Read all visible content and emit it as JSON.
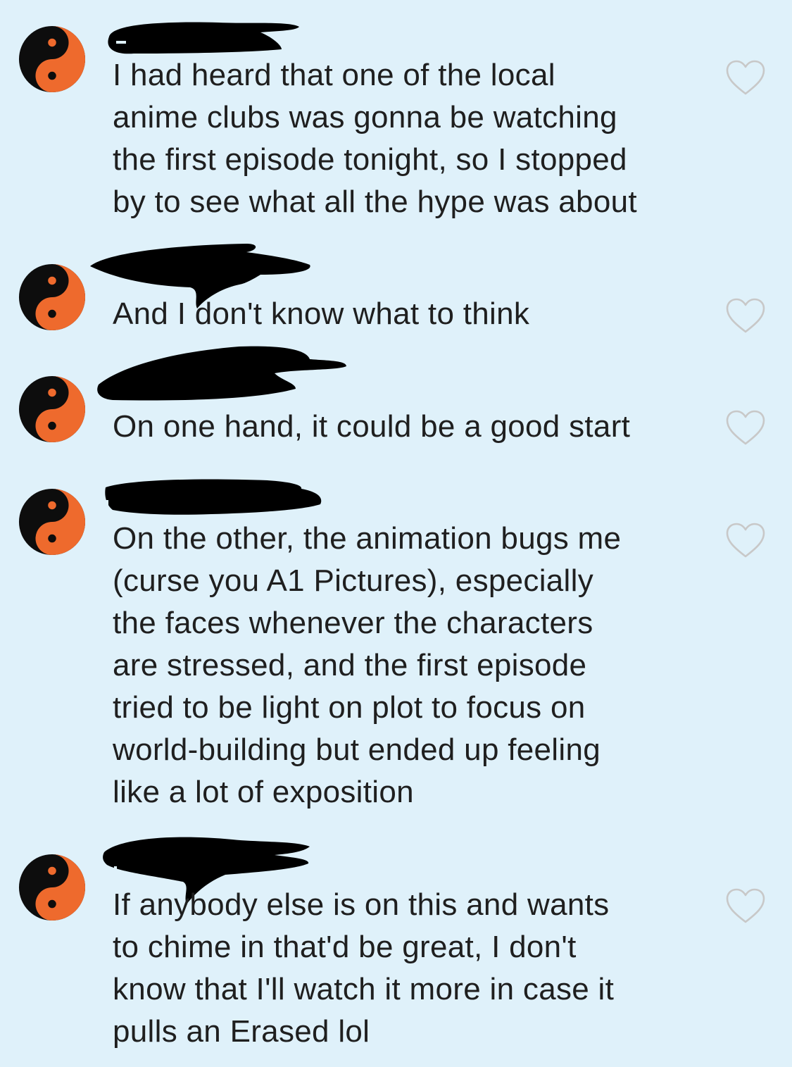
{
  "comments": [
    {
      "text": "I had heard that one of the local\nanime clubs was gonna be watching\nthe first episode tonight, so I stopped\nby to see what all the hype was about"
    },
    {
      "text": "And I don't know what to think"
    },
    {
      "text": "On one hand, it could be a good start"
    },
    {
      "text": "On the other, the animation bugs me\n(curse you A1 Pictures), especially\nthe faces whenever the characters\nare stressed, and the first episode\ntried to be light on plot to focus on\nworld-building but ended up feeling\nlike a lot of exposition"
    },
    {
      "text": "If anybody else is on this and wants\nto chime in that'd be great, I don't\nknow that I'll watch it more in case it\npulls an Erased lol"
    }
  ],
  "icons": {
    "avatar": "yin-yang-icon",
    "like": "heart-outline-icon",
    "redaction": "redacted-username-scribble"
  },
  "colors": {
    "background": "#dff1fa",
    "text": "#1f1f1f",
    "avatar_orange": "#ee6a2d",
    "avatar_black": "#0d0d0d",
    "heart_stroke": "#c8c8c8"
  }
}
